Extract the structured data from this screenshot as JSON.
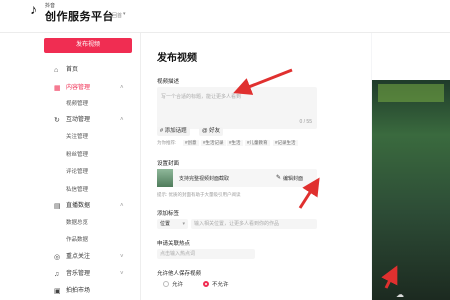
{
  "header": {
    "logo_icon": "tiktok-note-icon",
    "brand_small": "抖音",
    "title": "创作服务平台",
    "subtitle": "回首",
    "caret": "▾"
  },
  "sidebar": {
    "publish_button": "发布视频",
    "items": [
      {
        "icon": "home-icon",
        "glyph": "⌂",
        "label": "首页"
      },
      {
        "icon": "content-icon",
        "glyph": "▦",
        "label": "内容管理",
        "active": true,
        "caret": "˄"
      },
      {
        "sub": "视频管理"
      },
      {
        "icon": "interact-icon",
        "glyph": "↻",
        "label": "互动管理",
        "caret": "˄"
      },
      {
        "sub": "关注管理"
      },
      {
        "sub": "粉丝管理"
      },
      {
        "sub": "评论管理"
      },
      {
        "sub": "私信管理"
      },
      {
        "icon": "data-icon",
        "glyph": "▤",
        "label": "直播数据",
        "caret": "˄"
      },
      {
        "sub": "数据总览"
      },
      {
        "sub": "作品数据"
      },
      {
        "icon": "focus-icon",
        "glyph": "◎",
        "label": "重点关注",
        "caret": "˅"
      },
      {
        "icon": "music-icon",
        "glyph": "♫",
        "label": "音乐管理",
        "caret": "˅"
      },
      {
        "icon": "shoot-icon",
        "glyph": "▣",
        "label": "拍拍市场"
      }
    ]
  },
  "main": {
    "title": "发布视频",
    "desc_label": "视频描述",
    "desc_placeholder": "写一个合适的标题，能让更多人看到",
    "desc_count": "0 / 55",
    "tag_topic": "# 添加话题",
    "tag_friend": "@ 好友",
    "recommend_label": "为你推荐:",
    "recommend_tags": [
      "#创意",
      "#生活记录",
      "#生活",
      "#儿童教育",
      "#记录生活"
    ],
    "cover_label": "设置封面",
    "cover_text": "支持完整视频封面截取",
    "cover_edit": "编辑封面",
    "cover_hint": "提示: 优质的封面有助于大量吸引用户阅读",
    "location_label": "添加标签",
    "location_select": "位置",
    "location_caret": "▾",
    "location_placeholder": "输入相关位置，让更多人看到你的作品",
    "mini_label": "申请关联热点",
    "mini_placeholder": "点击输入热点词",
    "allow_label": "允许他人保存视频",
    "allow_yes": "允许",
    "allow_no": "不允许"
  },
  "preview": {
    "play_icon": "upload-cloud-icon"
  },
  "colors": {
    "accent": "#f02d52",
    "arrow": "#e0302f"
  }
}
